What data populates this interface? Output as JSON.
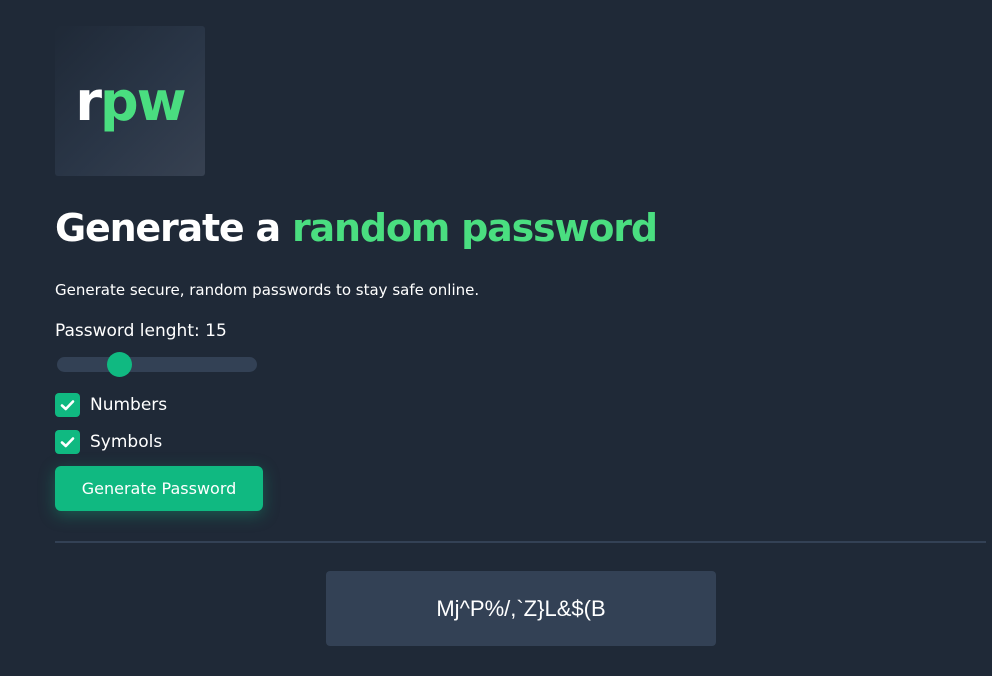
{
  "logo": {
    "part1": "r",
    "part2": "pw"
  },
  "headline": {
    "text": "Generate a ",
    "accent": "random password"
  },
  "subtitle": "Generate secure, random passwords to stay safe online.",
  "length": {
    "label_prefix": "Password lenght: ",
    "value": "15",
    "slider_fraction": 0.31
  },
  "options": [
    {
      "label": "Numbers",
      "checked": true,
      "icon": "checkmark-icon"
    },
    {
      "label": "Symbols",
      "checked": true,
      "icon": "checkmark-icon"
    }
  ],
  "button": {
    "label": "Generate Password"
  },
  "output": {
    "password": "Mj^P%/,`Z}L&$(B"
  },
  "colors": {
    "background": "#1f2937",
    "accent": "#4ade80",
    "button": "#10b981",
    "panel": "#334155"
  }
}
